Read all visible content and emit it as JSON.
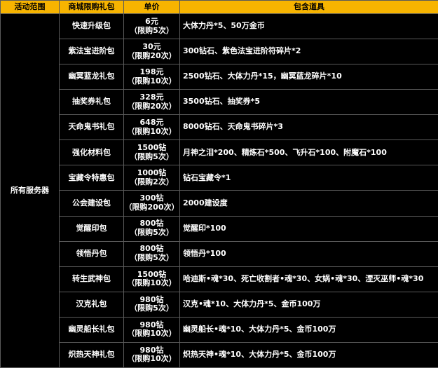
{
  "table": {
    "headers": [
      "活动范围",
      "商城限购礼包",
      "单价",
      "包含道具"
    ],
    "range": "所有服务器",
    "rows": [
      {
        "name": "快速升级包",
        "price": "6元",
        "limit": "（限购5次）",
        "items": "大体力丹*5、50万金币"
      },
      {
        "name": "紫法宝进阶包",
        "price": "30元",
        "limit": "（限购20次）",
        "items": "300钻石、紫色法宝进阶符碎片*2"
      },
      {
        "name": "幽冥蓝龙礼包",
        "price": "198元",
        "limit": "（限购10次）",
        "items": "2500钻石、大体力丹*15，幽冥蓝龙碎片*10"
      },
      {
        "name": "抽奖券礼包",
        "price": "328元",
        "limit": "（限购20次）",
        "items": "3500钻石、抽奖券*5"
      },
      {
        "name": "天命鬼书礼包",
        "price": "648元",
        "limit": "（限购10次）",
        "items": "8000钻石、天命鬼书碎片*3"
      },
      {
        "name": "强化材料包",
        "price": "1500钻",
        "limit": "（限购5次）",
        "items": "月神之泪*200、精炼石*500、飞升石*100、附魔石*100"
      },
      {
        "name": "宝藏令特惠包",
        "price": "1000钻",
        "limit": "（限购2次）",
        "items": "钻石宝藏令*1"
      },
      {
        "name": "公会建设包",
        "price": "300钻",
        "limit": "（限购200次）",
        "items": "2000建设度"
      },
      {
        "name": "觉醒印包",
        "price": "800钻",
        "limit": "（限购5次）",
        "items": "觉醒印*100"
      },
      {
        "name": "领悟丹包",
        "price": "800钻",
        "limit": "（限购5次）",
        "items": "领悟丹*100"
      },
      {
        "name": "转生武神包",
        "price": "1500钻",
        "limit": "（限购10次）",
        "items": "哈迪斯•魂*30、死亡收割者•魂*30、女娲•魂*30、湮灭巫师•魂*30"
      },
      {
        "name": "汉克礼包",
        "price": "980钻",
        "limit": "（限购5次）",
        "items": "汉克•魂*10、大体力丹*5、金币100万"
      },
      {
        "name": "幽灵船长礼包",
        "price": "980钻",
        "limit": "（限购10次）",
        "items": "幽灵船长•魂*10、大体力丹*5、金币100万"
      },
      {
        "name": "炽热天神礼包",
        "price": "980钻",
        "limit": "（限购10次）",
        "items": "炽热天神•魂*10、大体力丹*5、金币100万"
      }
    ]
  },
  "colors": {
    "header_bg": "#f7b400",
    "body_bg": "#000000",
    "text": "#ffffff",
    "border": "#5a5a5a"
  }
}
